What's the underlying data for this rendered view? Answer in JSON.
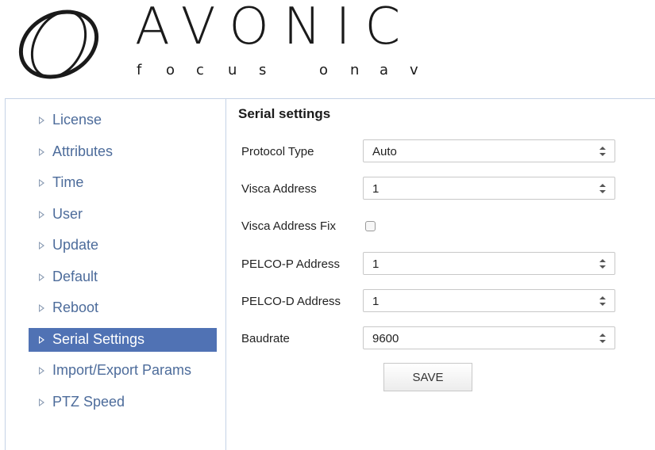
{
  "brand": {
    "name": "AVONIC",
    "tagline_letters": [
      "f",
      "o",
      "c",
      "u",
      "s",
      "o",
      "n",
      "a",
      "v"
    ]
  },
  "sidebar": {
    "items": [
      {
        "label": "License",
        "active": false
      },
      {
        "label": "Attributes",
        "active": false
      },
      {
        "label": "Time",
        "active": false
      },
      {
        "label": "User",
        "active": false
      },
      {
        "label": "Update",
        "active": false
      },
      {
        "label": "Default",
        "active": false
      },
      {
        "label": "Reboot",
        "active": false
      },
      {
        "label": "Serial Settings",
        "active": true
      },
      {
        "label": "Import/Export Params",
        "active": false
      },
      {
        "label": "PTZ Speed",
        "active": false
      }
    ]
  },
  "form": {
    "title": "Serial settings",
    "protocol_type": {
      "label": "Protocol Type",
      "value": "Auto"
    },
    "visca_address": {
      "label": "Visca Address",
      "value": "1"
    },
    "visca_address_fix": {
      "label": "Visca Address Fix",
      "checked": false
    },
    "pelco_p_address": {
      "label": "PELCO-P Address",
      "value": "1"
    },
    "pelco_d_address": {
      "label": "PELCO-D Address",
      "value": "1"
    },
    "baudrate": {
      "label": "Baudrate",
      "value": "9600"
    },
    "save_label": "SAVE"
  },
  "colors": {
    "accent": "#5072b4",
    "nav_text": "#4d6c9b",
    "border": "#c5d3e6"
  }
}
